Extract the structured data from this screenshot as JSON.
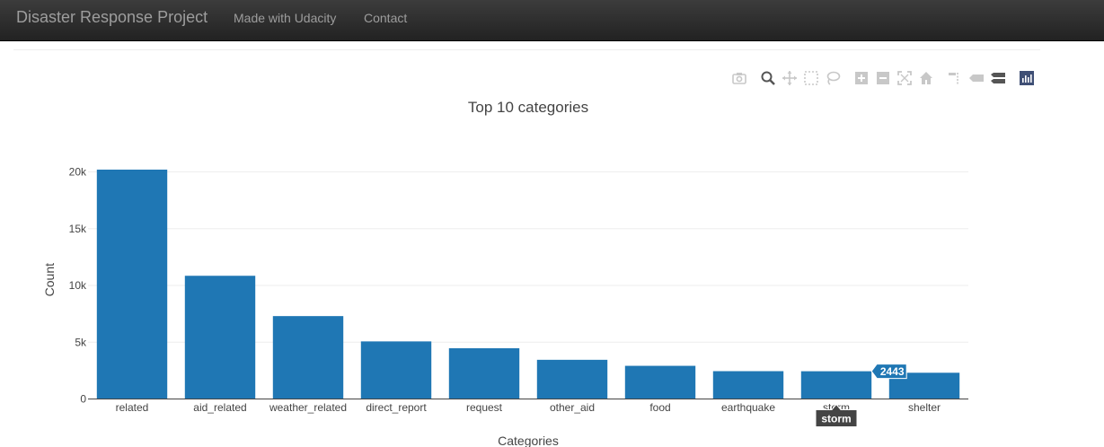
{
  "navbar": {
    "brand": "Disaster Response Project",
    "links": [
      "Made with Udacity",
      "Contact"
    ]
  },
  "modebar": {
    "icons": [
      "camera-icon",
      "zoom-icon",
      "pan-icon",
      "box-select-icon",
      "lasso-select-icon",
      "zoom-in-icon",
      "zoom-out-icon",
      "autoscale-icon",
      "reset-axes-icon",
      "spike-lines-icon",
      "hover-closest-icon",
      "hover-compare-icon",
      "plotly-logo-icon"
    ]
  },
  "colors": {
    "bar": "#1f77b4",
    "navbar": "#222222",
    "hover_label_bg": "#444444"
  },
  "chart_data": {
    "type": "bar",
    "title": "Top 10 categories",
    "xlabel": "Categories",
    "ylabel": "Count",
    "categories": [
      "related",
      "aid_related",
      "weather_related",
      "direct_report",
      "request",
      "other_aid",
      "food",
      "earthquake",
      "storm",
      "shelter"
    ],
    "values": [
      20200,
      10850,
      7300,
      5070,
      4470,
      3450,
      2920,
      2450,
      2443,
      2310
    ],
    "ylim": [
      0,
      21000
    ],
    "yticks": [
      0,
      5000,
      10000,
      15000,
      20000
    ],
    "ytick_labels": [
      "0",
      "5k",
      "10k",
      "15k",
      "20k"
    ],
    "grid": true,
    "hover": {
      "category": "storm",
      "value_label": "2443"
    }
  }
}
